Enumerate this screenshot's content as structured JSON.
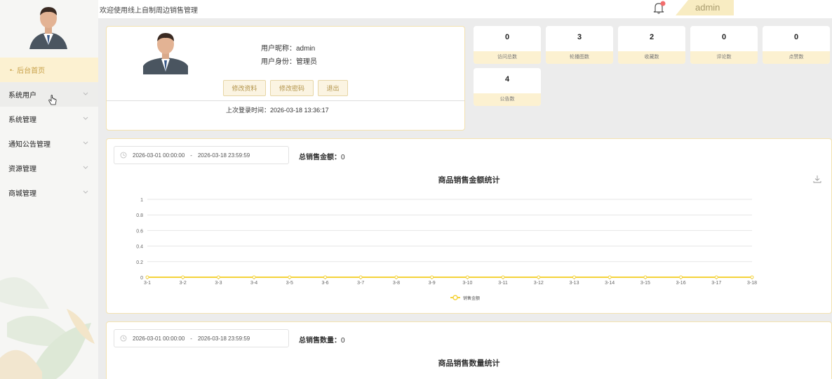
{
  "header": {
    "welcome": "欢迎使用线上自制周边销售管理",
    "user": "admin",
    "notification_icon": "bell-icon",
    "accent": "#c8a14a"
  },
  "sidebar": {
    "items": [
      {
        "label": "后台首页",
        "icon": "arrow-left-icon"
      },
      {
        "label": "系统用户"
      },
      {
        "label": "系统管理"
      },
      {
        "label": "通知公告管理"
      },
      {
        "label": "资源管理"
      },
      {
        "label": "商城管理"
      }
    ]
  },
  "profile": {
    "nickname_label": "用户昵称：",
    "nickname": "admin",
    "role_label": "用户身份：",
    "role": "管理员",
    "buttons": {
      "edit": "修改资料",
      "password": "修改密码",
      "logout": "退出"
    },
    "last_login_label": "上次登录时间：",
    "last_login": "2026-03-18 13:36:17"
  },
  "stats": [
    {
      "value": "0",
      "label": "访问总数"
    },
    {
      "value": "3",
      "label": "轮播图数"
    },
    {
      "value": "2",
      "label": "收藏数"
    },
    {
      "value": "0",
      "label": "评论数"
    },
    {
      "value": "0",
      "label": "点赞数"
    },
    {
      "value": "4",
      "label": "公告数"
    }
  ],
  "amount_panel": {
    "date_start": "2026-03-01 00:00:00",
    "date_sep": "-",
    "date_end": "2026-03-18 23:59:59",
    "total_label": "总销售金额：",
    "total_value": "0",
    "title": "商品销售金额统计"
  },
  "qty_panel": {
    "date_start": "2026-03-01 00:00:00",
    "date_sep": "-",
    "date_end": "2026-03-18 23:59:59",
    "total_label": "总销售数量：",
    "total_value": "0",
    "title": "商品销售数量统计"
  },
  "chart_data": {
    "type": "line",
    "title": "商品销售金额统计",
    "categories": [
      "3-1",
      "3-2",
      "3-3",
      "3-4",
      "3-5",
      "3-6",
      "3-7",
      "3-8",
      "3-9",
      "3-10",
      "3-11",
      "3-12",
      "3-13",
      "3-14",
      "3-15",
      "3-16",
      "3-17",
      "3-18"
    ],
    "series": [
      {
        "name": "销售金额",
        "values": [
          0,
          0,
          0,
          0,
          0,
          0,
          0,
          0,
          0,
          0,
          0,
          0,
          0,
          0,
          0,
          0,
          0,
          0
        ],
        "color": "#f5d33a"
      }
    ],
    "yticks": [
      "0",
      "0.2",
      "0.4",
      "0.6",
      "0.8",
      "1"
    ],
    "ylim": [
      0,
      1
    ],
    "grid": true,
    "legend": "bottom-center"
  }
}
